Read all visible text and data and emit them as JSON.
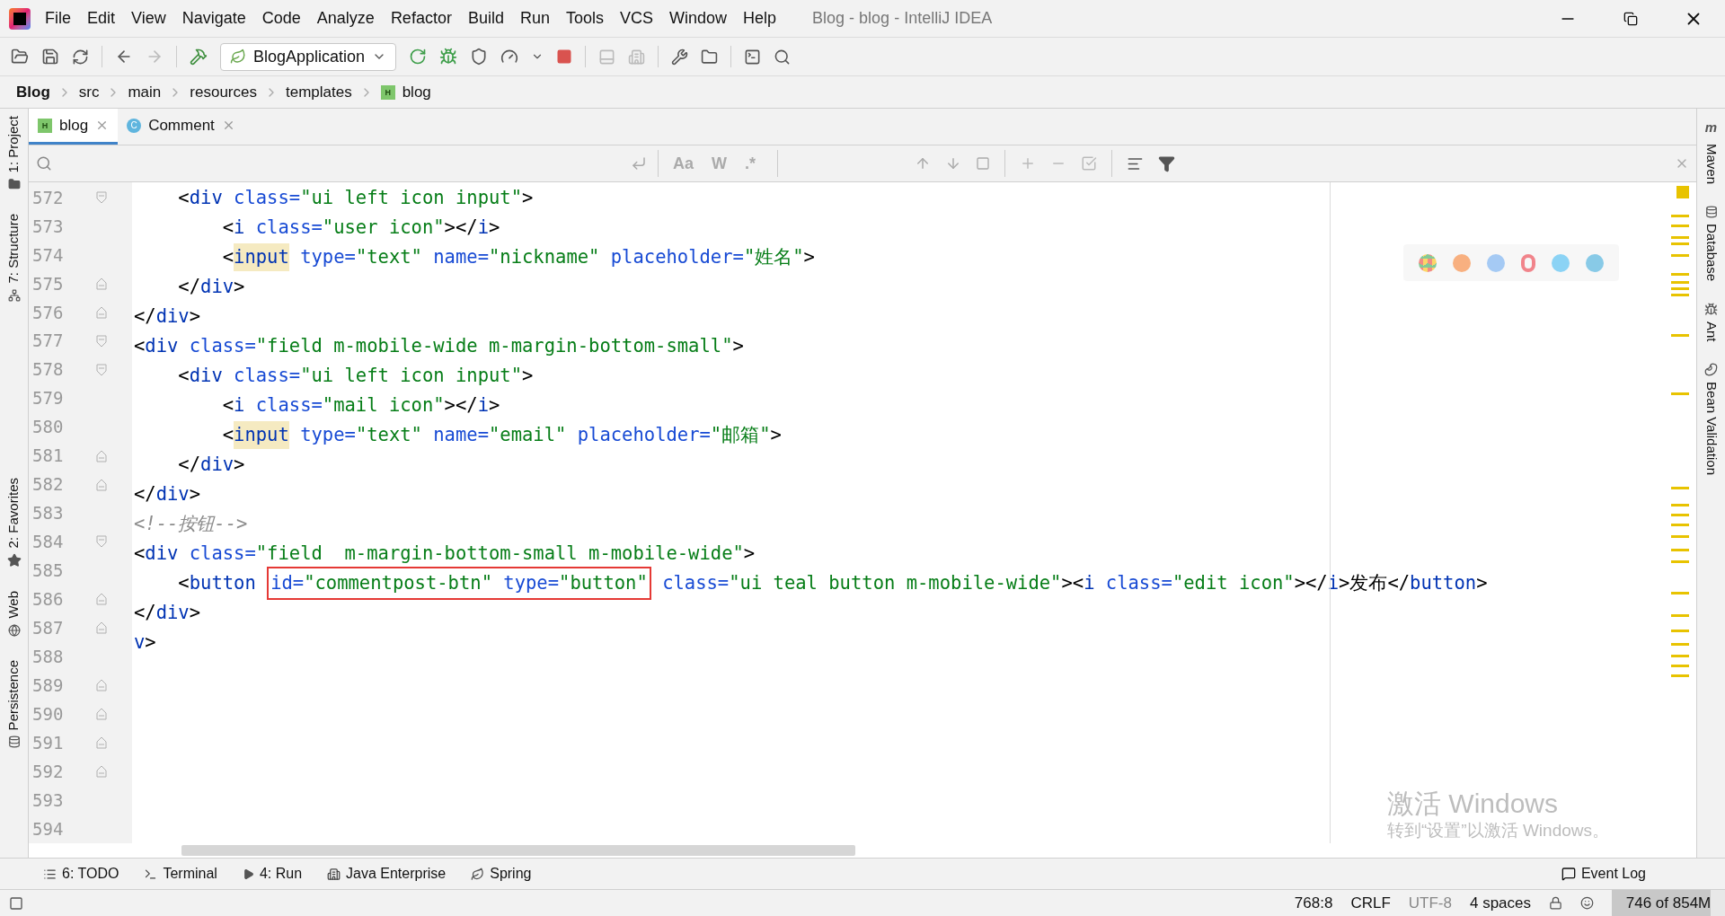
{
  "window": {
    "title": "Blog - blog - IntelliJ IDEA"
  },
  "menu": [
    "File",
    "Edit",
    "View",
    "Navigate",
    "Code",
    "Analyze",
    "Refactor",
    "Build",
    "Run",
    "Tools",
    "VCS",
    "Window",
    "Help"
  ],
  "toolbar": {
    "run_config": "BlogApplication"
  },
  "breadcrumbs": [
    {
      "label": "Blog",
      "kind": "project"
    },
    {
      "label": "src",
      "kind": "folder"
    },
    {
      "label": "main",
      "kind": "folder"
    },
    {
      "label": "resources",
      "kind": "folder"
    },
    {
      "label": "templates",
      "kind": "folder"
    },
    {
      "label": "blog",
      "kind": "html",
      "icon_letter": "H"
    }
  ],
  "tabs": [
    {
      "label": "blog",
      "kind": "html",
      "icon_letter": "H",
      "selected": true
    },
    {
      "label": "Comment",
      "kind": "class",
      "icon_letter": "C",
      "selected": false
    }
  ],
  "left_tools": [
    {
      "label": "1: Project",
      "kind": "folder"
    },
    {
      "label": "7: Structure",
      "kind": "structure"
    },
    {
      "label": "2: Favorites",
      "kind": "star"
    },
    {
      "label": "Web",
      "kind": "globe"
    },
    {
      "label": "Persistence",
      "kind": "db"
    }
  ],
  "right_tools": [
    {
      "label": "Maven",
      "kind": "m"
    },
    {
      "label": "Database",
      "kind": "db"
    },
    {
      "label": "Ant",
      "kind": "ant"
    },
    {
      "label": "Bean Validation",
      "kind": "bean"
    }
  ],
  "search_bar": {
    "options": [
      "Aa",
      "W",
      ".*"
    ]
  },
  "code_lines": [
    {
      "number": "572",
      "kind": "block-start",
      "tokens": [
        {
          "kind": "punct",
          "text": "    <"
        },
        {
          "kind": "tag",
          "text": "div"
        },
        {
          "kind": "attr",
          "text": " class="
        },
        {
          "kind": "string",
          "text": "\"ui left icon input\""
        },
        {
          "kind": "punct",
          "text": ">"
        }
      ]
    },
    {
      "number": "573",
      "kind": "plain",
      "tokens": [
        {
          "kind": "punct",
          "text": "        <"
        },
        {
          "kind": "tag",
          "text": "i"
        },
        {
          "kind": "attr",
          "text": " class="
        },
        {
          "kind": "string",
          "text": "\"user icon\""
        },
        {
          "kind": "punct",
          "text": "></"
        },
        {
          "kind": "tag",
          "text": "i"
        },
        {
          "kind": "punct",
          "text": ">"
        }
      ]
    },
    {
      "number": "574",
      "kind": "plain",
      "tokens": [
        {
          "kind": "punct",
          "text": "        <"
        },
        {
          "kind": "match",
          "text": "input"
        },
        {
          "kind": "attr",
          "text": " type="
        },
        {
          "kind": "string",
          "text": "\"text\""
        },
        {
          "kind": "attr",
          "text": " name="
        },
        {
          "kind": "string",
          "text": "\"nickname\""
        },
        {
          "kind": "attr",
          "text": " placeholder="
        },
        {
          "kind": "string",
          "text": "\"姓名\""
        },
        {
          "kind": "punct",
          "text": ">"
        }
      ]
    },
    {
      "number": "575",
      "kind": "block-end",
      "tokens": [
        {
          "kind": "punct",
          "text": "    </"
        },
        {
          "kind": "tag",
          "text": "div"
        },
        {
          "kind": "punct",
          "text": ">"
        }
      ]
    },
    {
      "number": "576",
      "kind": "block-end",
      "tokens": [
        {
          "kind": "punct",
          "text": "</"
        },
        {
          "kind": "tag",
          "text": "div"
        },
        {
          "kind": "punct",
          "text": ">"
        }
      ]
    },
    {
      "number": "577",
      "kind": "block-start",
      "tokens": [
        {
          "kind": "punct",
          "text": "<"
        },
        {
          "kind": "tag",
          "text": "div"
        },
        {
          "kind": "attr",
          "text": " class="
        },
        {
          "kind": "string",
          "text": "\"field m-mobile-wide m-margin-bottom-small\""
        },
        {
          "kind": "punct",
          "text": ">"
        }
      ]
    },
    {
      "number": "578",
      "kind": "block-start",
      "tokens": [
        {
          "kind": "punct",
          "text": "    <"
        },
        {
          "kind": "tag",
          "text": "div"
        },
        {
          "kind": "attr",
          "text": " class="
        },
        {
          "kind": "string",
          "text": "\"ui left icon input\""
        },
        {
          "kind": "punct",
          "text": ">"
        }
      ]
    },
    {
      "number": "579",
      "kind": "plain",
      "tokens": [
        {
          "kind": "punct",
          "text": "        <"
        },
        {
          "kind": "tag",
          "text": "i"
        },
        {
          "kind": "attr",
          "text": " class="
        },
        {
          "kind": "string",
          "text": "\"mail icon\""
        },
        {
          "kind": "punct",
          "text": "></"
        },
        {
          "kind": "tag",
          "text": "i"
        },
        {
          "kind": "punct",
          "text": ">"
        }
      ]
    },
    {
      "number": "580",
      "kind": "plain",
      "tokens": [
        {
          "kind": "punct",
          "text": "        <"
        },
        {
          "kind": "match",
          "text": "input"
        },
        {
          "kind": "attr",
          "text": " type="
        },
        {
          "kind": "string",
          "text": "\"text\""
        },
        {
          "kind": "attr",
          "text": " name="
        },
        {
          "kind": "string",
          "text": "\"email\""
        },
        {
          "kind": "attr",
          "text": " placeholder="
        },
        {
          "kind": "string",
          "text": "\"邮箱\""
        },
        {
          "kind": "punct",
          "text": ">"
        }
      ]
    },
    {
      "number": "581",
      "kind": "block-end",
      "tokens": [
        {
          "kind": "punct",
          "text": "    </"
        },
        {
          "kind": "tag",
          "text": "div"
        },
        {
          "kind": "punct",
          "text": ">"
        }
      ]
    },
    {
      "number": "582",
      "kind": "block-end",
      "tokens": [
        {
          "kind": "punct",
          "text": "</"
        },
        {
          "kind": "tag",
          "text": "div"
        },
        {
          "kind": "punct",
          "text": ">"
        }
      ]
    },
    {
      "number": "583",
      "kind": "plain",
      "tokens": [
        {
          "kind": "comment",
          "text": "<!--按钮-->"
        }
      ]
    },
    {
      "number": "584",
      "kind": "block-start",
      "tokens": [
        {
          "kind": "punct",
          "text": "<"
        },
        {
          "kind": "tag",
          "text": "div"
        },
        {
          "kind": "attr",
          "text": " class="
        },
        {
          "kind": "string",
          "text": "\"field  m-margin-bottom-small m-mobile-wide\""
        },
        {
          "kind": "punct",
          "text": ">"
        }
      ]
    },
    {
      "number": "585",
      "kind": "plain",
      "tokens": [
        {
          "kind": "punct",
          "text": "    <"
        },
        {
          "kind": "tag",
          "text": "button "
        },
        {
          "kind": "box",
          "tokens": [
            {
              "kind": "attr",
              "text": "id="
            },
            {
              "kind": "string",
              "text": "\"commentpost-btn\""
            },
            {
              "kind": "attr",
              "text": " type="
            },
            {
              "kind": "string",
              "text": "\"button\""
            }
          ]
        },
        {
          "kind": "attr",
          "text": " class="
        },
        {
          "kind": "string",
          "text": "\"ui teal button m-mobile-wide\""
        },
        {
          "kind": "punct",
          "text": "><"
        },
        {
          "kind": "tag",
          "text": "i"
        },
        {
          "kind": "attr",
          "text": " class="
        },
        {
          "kind": "string",
          "text": "\"edit icon\""
        },
        {
          "kind": "punct",
          "text": "></"
        },
        {
          "kind": "tag",
          "text": "i"
        },
        {
          "kind": "punct",
          "text": ">"
        },
        {
          "kind": "text",
          "text": "发布"
        },
        {
          "kind": "punct",
          "text": "</"
        },
        {
          "kind": "tag",
          "text": "button"
        },
        {
          "kind": "punct",
          "text": ">"
        }
      ]
    },
    {
      "number": "586",
      "kind": "block-end",
      "tokens": [
        {
          "kind": "punct",
          "text": "</"
        },
        {
          "kind": "tag",
          "text": "div"
        },
        {
          "kind": "punct",
          "text": ">"
        }
      ]
    },
    {
      "number": "587",
      "kind": "block-end",
      "tokens": [
        {
          "kind": "tag",
          "text": "v"
        },
        {
          "kind": "punct",
          "text": ">"
        }
      ]
    },
    {
      "number": "588",
      "kind": "plain"
    },
    {
      "number": "589",
      "kind": "block-end"
    },
    {
      "number": "590",
      "kind": "block-end"
    },
    {
      "number": "591",
      "kind": "block-end"
    },
    {
      "number": "592",
      "kind": "block-end"
    },
    {
      "number": "593",
      "kind": "plain"
    },
    {
      "number": "594",
      "kind": "plain"
    }
  ],
  "activation_notice": {
    "title": "激活 Windows",
    "subtitle": "转到“设置”以激活 Windows。"
  },
  "bottom_tools": [
    {
      "label": "6: TODO",
      "kind": "list"
    },
    {
      "label": "Terminal",
      "kind": "terminal"
    },
    {
      "label": "4: Run",
      "kind": "run"
    },
    {
      "label": "Java Enterprise",
      "kind": "enterprise"
    },
    {
      "label": "Spring",
      "kind": "leaf"
    }
  ],
  "event_log": "Event Log",
  "status": {
    "position": "768:8",
    "line_separator": "CRLF",
    "encoding": "UTF-8",
    "indent": "4 spaces",
    "memory": {
      "reading": "746 of 854M",
      "level": 0.87
    }
  }
}
